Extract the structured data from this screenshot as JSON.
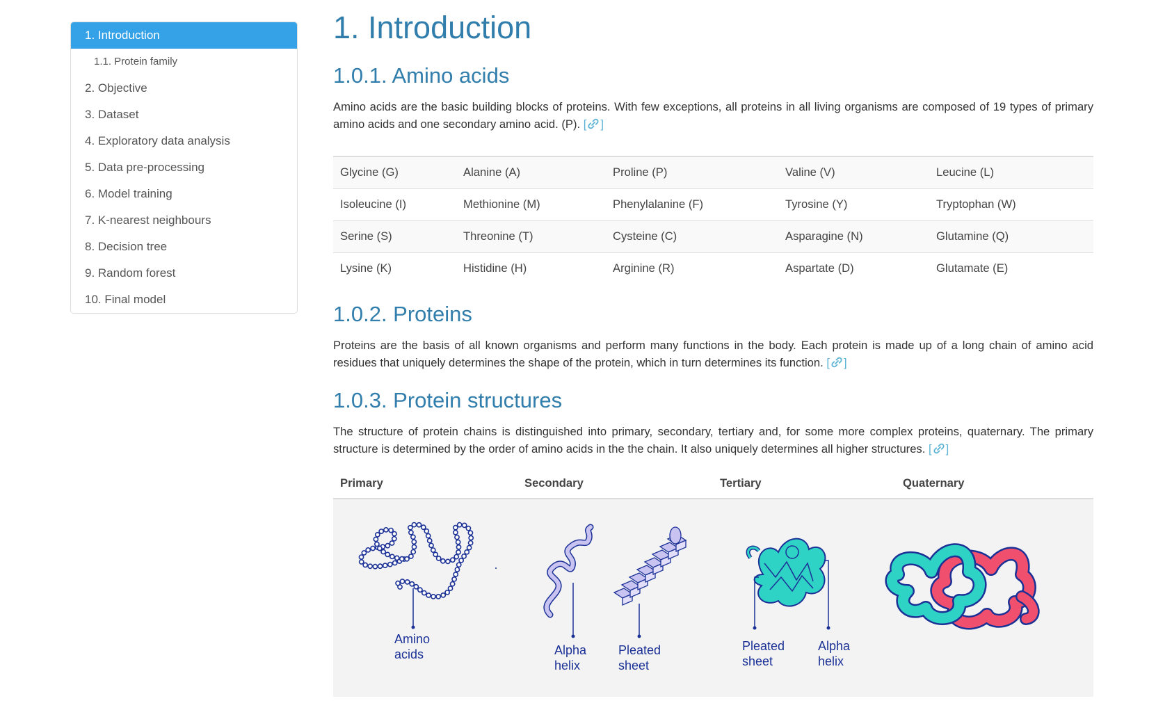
{
  "toc": {
    "items": [
      {
        "label": "1. Introduction"
      },
      {
        "label": "1.1. Protein family"
      },
      {
        "label": "2. Objective"
      },
      {
        "label": "3. Dataset"
      },
      {
        "label": "4. Exploratory data analysis"
      },
      {
        "label": "5. Data pre-processing"
      },
      {
        "label": "6. Model training"
      },
      {
        "label": "7. K-nearest neighbours"
      },
      {
        "label": "8. Decision tree"
      },
      {
        "label": "9. Random forest"
      },
      {
        "label": "10. Final model"
      }
    ],
    "active_index": 0
  },
  "content": {
    "title": "1. Introduction",
    "sections": [
      {
        "heading": "1.0.1. Amino acids",
        "text": "Amino acids are the basic building blocks of proteins. With few exceptions, all proteins in all living organisms are composed of 19 types of primary amino acids and one secondary amino acid. (P). "
      },
      {
        "heading": "1.0.2. Proteins",
        "text": "Proteins are the basis of all known organisms and perform many functions in the body. Each protein is made up of a long chain of amino acid residues that uniquely determines the shape of the protein, which in turn determines its function. "
      },
      {
        "heading": "1.0.3. Protein structures",
        "text": "The structure of protein chains is distinguished into primary, secondary, tertiary and, for some more complex proteins, quaternary. The primary structure is determined by the order of amino acids in the the chain. It also uniquely determines all higher structures. "
      }
    ],
    "ref_open": "[",
    "ref_close": "]",
    "link_icon": "link-icon",
    "amino_table": [
      [
        "Glycine (G)",
        "Alanine (A)",
        "Proline (P)",
        "Valine (V)",
        "Leucine (L)"
      ],
      [
        "Isoleucine (I)",
        "Methionine (M)",
        "Phenylalanine (F)",
        "Tyrosine (Y)",
        "Tryptophan (W)"
      ],
      [
        "Serine (S)",
        "Threonine (T)",
        "Cysteine (C)",
        "Asparagine (N)",
        "Glutamine (Q)"
      ],
      [
        "Lysine (K)",
        "Histidine (H)",
        "Arginine (R)",
        "Aspartate (D)",
        "Glutamate (E)"
      ]
    ],
    "structure_headers": [
      "Primary",
      "Secondary",
      "Tertiary",
      "Quaternary"
    ],
    "figure_labels": {
      "amino_acids": [
        "Amino",
        "acids"
      ],
      "secondary_alpha": [
        "Alpha",
        "helix"
      ],
      "secondary_pleated": [
        "Pleated",
        "sheet"
      ],
      "tertiary_pleated": [
        "Pleated",
        "sheet"
      ],
      "tertiary_alpha": [
        "Alpha",
        "helix"
      ]
    }
  },
  "colors": {
    "accent": "#35a2e8",
    "heading": "#317eac",
    "figure_navy": "#1b3196",
    "figure_teal": "#2ed3c6",
    "figure_red": "#f0506e",
    "figure_lavender": "#c9c3f2"
  }
}
